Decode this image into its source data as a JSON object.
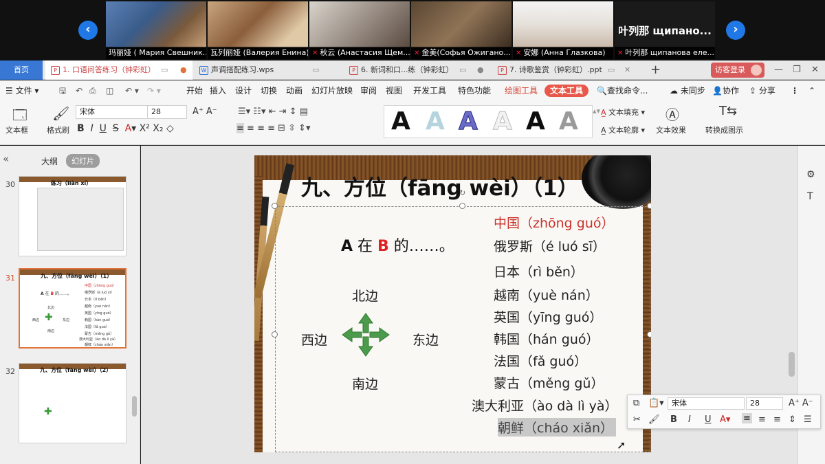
{
  "video": {
    "participants": [
      {
        "name": "玛丽娅 ( Мария Свешник...",
        "muted": false
      },
      {
        "name": "瓦列丽娅 (Валерия Енина)",
        "muted": false
      },
      {
        "name": "秋云 (Анастасия Щем...",
        "muted": true
      },
      {
        "name": "金美(Софья Ожигано...",
        "muted": true
      },
      {
        "name": "安娜 (Анна Глазкова)",
        "muted": true
      },
      {
        "name": "叶列那 щипанова еле...",
        "muted": true
      }
    ],
    "big_name": "叶列那 щипано...",
    "prev_icon": "‹",
    "next_icon": "›"
  },
  "tabs": {
    "home": "首页",
    "items": [
      {
        "label": "1. 口语问答练习（钟彩虹）",
        "icon": "P"
      },
      {
        "label": "声调搭配练习.wps",
        "icon": "W"
      },
      {
        "label": "6. 新词和口...练（钟彩虹）",
        "icon": "P"
      },
      {
        "label": "7. 诗歌鉴赏（钟彩虹）.ppt",
        "icon": "P"
      }
    ],
    "add": "+",
    "login": "访客登录"
  },
  "menu": {
    "file": "文件",
    "items": [
      "开始",
      "插入",
      "设计",
      "切换",
      "动画",
      "幻灯片放映",
      "审阅",
      "视图",
      "开发工具",
      "特色功能"
    ],
    "drawing_tools": "绘图工具",
    "text_tools": "文本工具",
    "search": "查找命令...",
    "sync": "未同步",
    "collab": "协作",
    "share": "分享"
  },
  "toolbar": {
    "textbox": "文本框",
    "format_painter": "格式刷",
    "font": "宋体",
    "size": "28",
    "text_fill": "文本填充",
    "text_outline": "文本轮廓",
    "text_effect": "文本效果",
    "convert": "转换成图示"
  },
  "left_panel": {
    "outline_tab": "大纲",
    "slides_tab": "幻灯片",
    "thumbs": [
      {
        "num": "30",
        "title": "练习（liàn xí）"
      },
      {
        "num": "31",
        "title": "九、方位（fāng wèi）（1）"
      },
      {
        "num": "32",
        "title": "九、方位（fāng wèi）（2）"
      }
    ]
  },
  "slide": {
    "title": "九、方位（fāng wèi）（1）",
    "phrase": {
      "a": "A",
      "mid": " 在 ",
      "b": "B",
      "end": " 的……。"
    },
    "directions": {
      "north": "北边",
      "south": "南边",
      "west": "西边",
      "east": "东边"
    },
    "countries": [
      "中国（zhōng guó）",
      "俄罗斯（é luó sī）",
      "日本（rì běn）",
      "越南（yuè nán）",
      "英国（yīng guó）",
      "韩国（hán guó）",
      "法国（fǎ guó）",
      "蒙古（měng gǔ）",
      "澳大利亚（ào dà lì yà）",
      "朝鲜（cháo xiǎn）"
    ]
  },
  "float_bar": {
    "font": "宋体",
    "size": "28"
  }
}
